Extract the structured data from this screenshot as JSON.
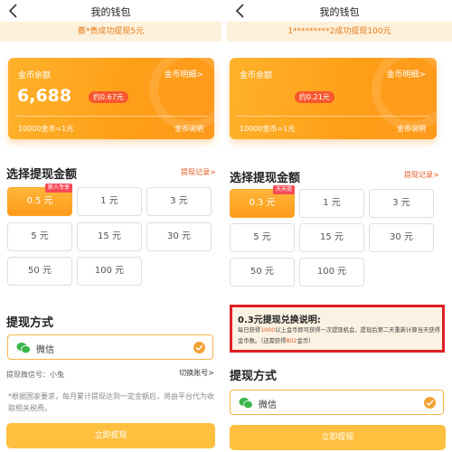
{
  "left": {
    "header": {
      "title": "我的钱包"
    },
    "notice": "蔡*贵成功提现5元",
    "card": {
      "label": "金币余额",
      "detail_link": "金币明细>",
      "balance": "6,688",
      "approx": "约0.67元",
      "rate": "10000金币=1元",
      "explain_link": "金币说明"
    },
    "section_amount": {
      "title": "选择提现金额",
      "record_link": "提现记录>"
    },
    "amounts": [
      {
        "label": "0.5 元",
        "tag": "新人专享"
      },
      {
        "label": "1 元"
      },
      {
        "label": "3 元"
      },
      {
        "label": "5 元"
      },
      {
        "label": "15 元"
      },
      {
        "label": "30 元"
      },
      {
        "label": "50 元"
      },
      {
        "label": "100 元"
      }
    ],
    "section_method": {
      "title": "提现方式"
    },
    "wechat_label": "微信",
    "account_label": "提现微信号：小兔",
    "switch_link": "切换账号>",
    "note": "*根据国家要求，每月累计提现达到一定金额后，将由平台代为收取相关税费。",
    "submit_label": "立即提现"
  },
  "right": {
    "header": {
      "title": "我的钱包"
    },
    "notice": "1*********2成功提现100元",
    "card": {
      "label": "金币余额",
      "detail_link": "金币明细>",
      "approx": "约0.21元",
      "rate": "10000金币=1元",
      "explain_link": "金币说明"
    },
    "section_amount": {
      "title": "选择提现金额",
      "record_link": "提现记录>"
    },
    "amounts": [
      {
        "label": "0.3 元",
        "tag": "天天提"
      },
      {
        "label": "1 元"
      },
      {
        "label": "3 元"
      },
      {
        "label": "5 元"
      },
      {
        "label": "15 元"
      },
      {
        "label": "30 元"
      },
      {
        "label": "50 元"
      },
      {
        "label": "100 元"
      }
    ],
    "rule": {
      "title": "0.3元提现兑换说明:",
      "t1": "每日获得",
      "h1": "1000",
      "t2": "以上金币即可获得一次提现机会，提现后第二天重新计算当天获得金币数。（还需获得",
      "h2": "802",
      "t3": "金币）"
    },
    "section_method": {
      "title": "提现方式"
    },
    "wechat_label": "微信",
    "submit_label": "立即提现"
  },
  "colors": {
    "accent": "#ff9e18",
    "tag_red": "#f74b58",
    "highlight": "#e6571f",
    "annotation_red": "#e11e25"
  }
}
